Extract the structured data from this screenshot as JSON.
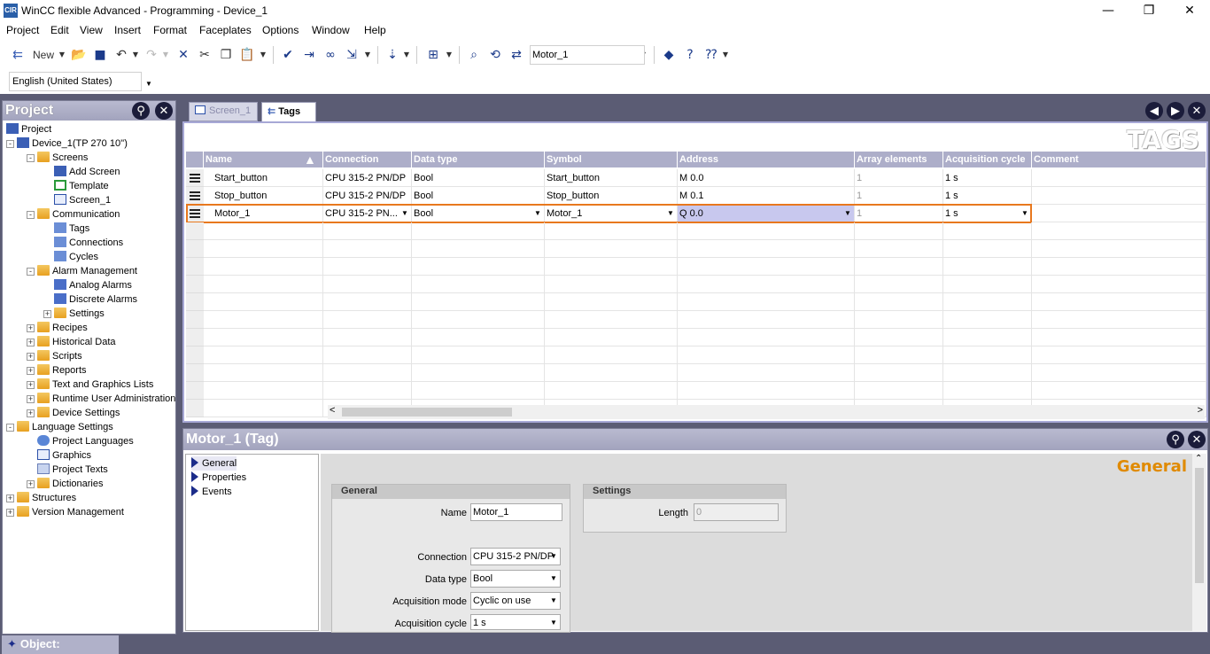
{
  "window": {
    "title": "WinCC flexible Advanced - Programming - Device_1",
    "app_icon": "CIR"
  },
  "menu": [
    "Project",
    "Edit",
    "View",
    "Insert",
    "Format",
    "Faceplates",
    "Options",
    "Window",
    "Help"
  ],
  "toolbar": {
    "new_label": "New",
    "object_field": "Motor_1",
    "language": "English (United States)"
  },
  "project_tree": {
    "header": "Project",
    "items": [
      {
        "label": "Project",
        "icon": "project-icon"
      },
      {
        "label": "Device_1(TP 270 10'')",
        "icon": "device-icon"
      },
      {
        "label": "Screens",
        "icon": "folder-icon"
      },
      {
        "label": "Add Screen",
        "icon": "add-screen-icon"
      },
      {
        "label": "Template",
        "icon": "template-icon"
      },
      {
        "label": "Screen_1",
        "icon": "screen-icon"
      },
      {
        "label": "Communication",
        "icon": "folder-icon"
      },
      {
        "label": "Tags",
        "icon": "tags-icon"
      },
      {
        "label": "Connections",
        "icon": "connections-icon"
      },
      {
        "label": "Cycles",
        "icon": "cycles-icon"
      },
      {
        "label": "Alarm Management",
        "icon": "folder-icon"
      },
      {
        "label": "Analog Alarms",
        "icon": "analog-alarm-icon"
      },
      {
        "label": "Discrete Alarms",
        "icon": "discrete-alarm-icon"
      },
      {
        "label": "Settings",
        "icon": "settings-icon"
      },
      {
        "label": "Recipes",
        "icon": "folder-icon"
      },
      {
        "label": "Historical Data",
        "icon": "folder-icon"
      },
      {
        "label": "Scripts",
        "icon": "folder-icon"
      },
      {
        "label": "Reports",
        "icon": "folder-icon"
      },
      {
        "label": "Text and Graphics Lists",
        "icon": "folder-icon"
      },
      {
        "label": "Runtime User Administration",
        "icon": "folder-icon"
      },
      {
        "label": "Device Settings",
        "icon": "folder-icon"
      },
      {
        "label": "Language Settings",
        "icon": "folder-icon"
      },
      {
        "label": "Project Languages",
        "icon": "globe-icon"
      },
      {
        "label": "Graphics",
        "icon": "graphics-icon"
      },
      {
        "label": "Project Texts",
        "icon": "texts-icon"
      },
      {
        "label": "Dictionaries",
        "icon": "folder-icon"
      },
      {
        "label": "Structures",
        "icon": "folder-icon"
      },
      {
        "label": "Version Management",
        "icon": "folder-icon"
      }
    ]
  },
  "tabs": [
    {
      "label": "Screen_1",
      "active": false
    },
    {
      "label": "Tags",
      "active": true
    }
  ],
  "tags_editor": {
    "banner": "TAGS",
    "columns": [
      "Name",
      "Connection",
      "Data type",
      "Symbol",
      "Address",
      "Array elements",
      "Acquisition cycle",
      "Comment"
    ],
    "rows": [
      [
        "Start_button",
        "CPU 315-2 PN/DP",
        "Bool",
        "Start_button",
        "M 0.0",
        "1",
        "1 s",
        ""
      ],
      [
        "Stop_button",
        "CPU 315-2 PN/DP",
        "Bool",
        "Stop_button",
        "M 0.1",
        "1",
        "1 s",
        ""
      ],
      [
        "Motor_1",
        "CPU 315-2 PN...",
        "Bool",
        "Motor_1",
        "Q 0.0",
        "1",
        "1 s",
        ""
      ]
    ],
    "selected_row": 2,
    "highlight_color": "#e8781e"
  },
  "properties": {
    "header": "Motor_1 (Tag)",
    "nav": [
      "General",
      "Properties",
      "Events"
    ],
    "section_banner": "General",
    "general_group": "General",
    "settings_group": "Settings",
    "fields": {
      "name_label": "Name",
      "name_value": "Motor_1",
      "connection_label": "Connection",
      "connection_value": "CPU 315-2 PN/DP",
      "datatype_label": "Data type",
      "datatype_value": "Bool",
      "acqmode_label": "Acquisition mode",
      "acqmode_value": "Cyclic on use",
      "acqcycle_label": "Acquisition cycle",
      "acqcycle_value": "1 s",
      "length_label": "Length",
      "length_value": "0"
    }
  },
  "status": {
    "label": "Object:"
  }
}
